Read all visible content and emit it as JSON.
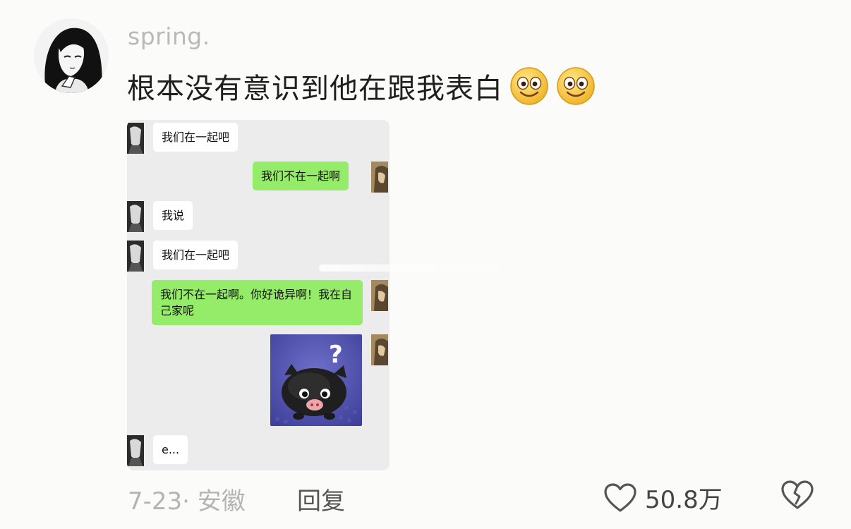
{
  "comment": {
    "username": "spring.",
    "text": "根本没有意识到他在跟我表白",
    "emojis": [
      "smile-emoji",
      "smile-emoji"
    ],
    "date_location": "7-23· 安徽",
    "reply_label": "回复",
    "like_count": "50.8万"
  },
  "chat_screenshot": {
    "messages": [
      {
        "side": "left",
        "text": "我们在一起吧"
      },
      {
        "side": "right",
        "text": "我们不在一起啊"
      },
      {
        "side": "left",
        "text": "我说"
      },
      {
        "side": "left",
        "text": "我们在一起吧"
      },
      {
        "side": "right",
        "text": "我们不在一起啊。你好诡异啊！我在自己家呢"
      },
      {
        "side": "right",
        "type": "sticker",
        "sticker": "confused-black-pig-sticker",
        "text": "?"
      },
      {
        "side": "left",
        "text": "e..."
      }
    ]
  },
  "colors": {
    "background": "#fbfbf9",
    "outgoing_bubble": "#95ec69",
    "incoming_bubble": "#ffffff",
    "chat_background": "#ececec"
  }
}
